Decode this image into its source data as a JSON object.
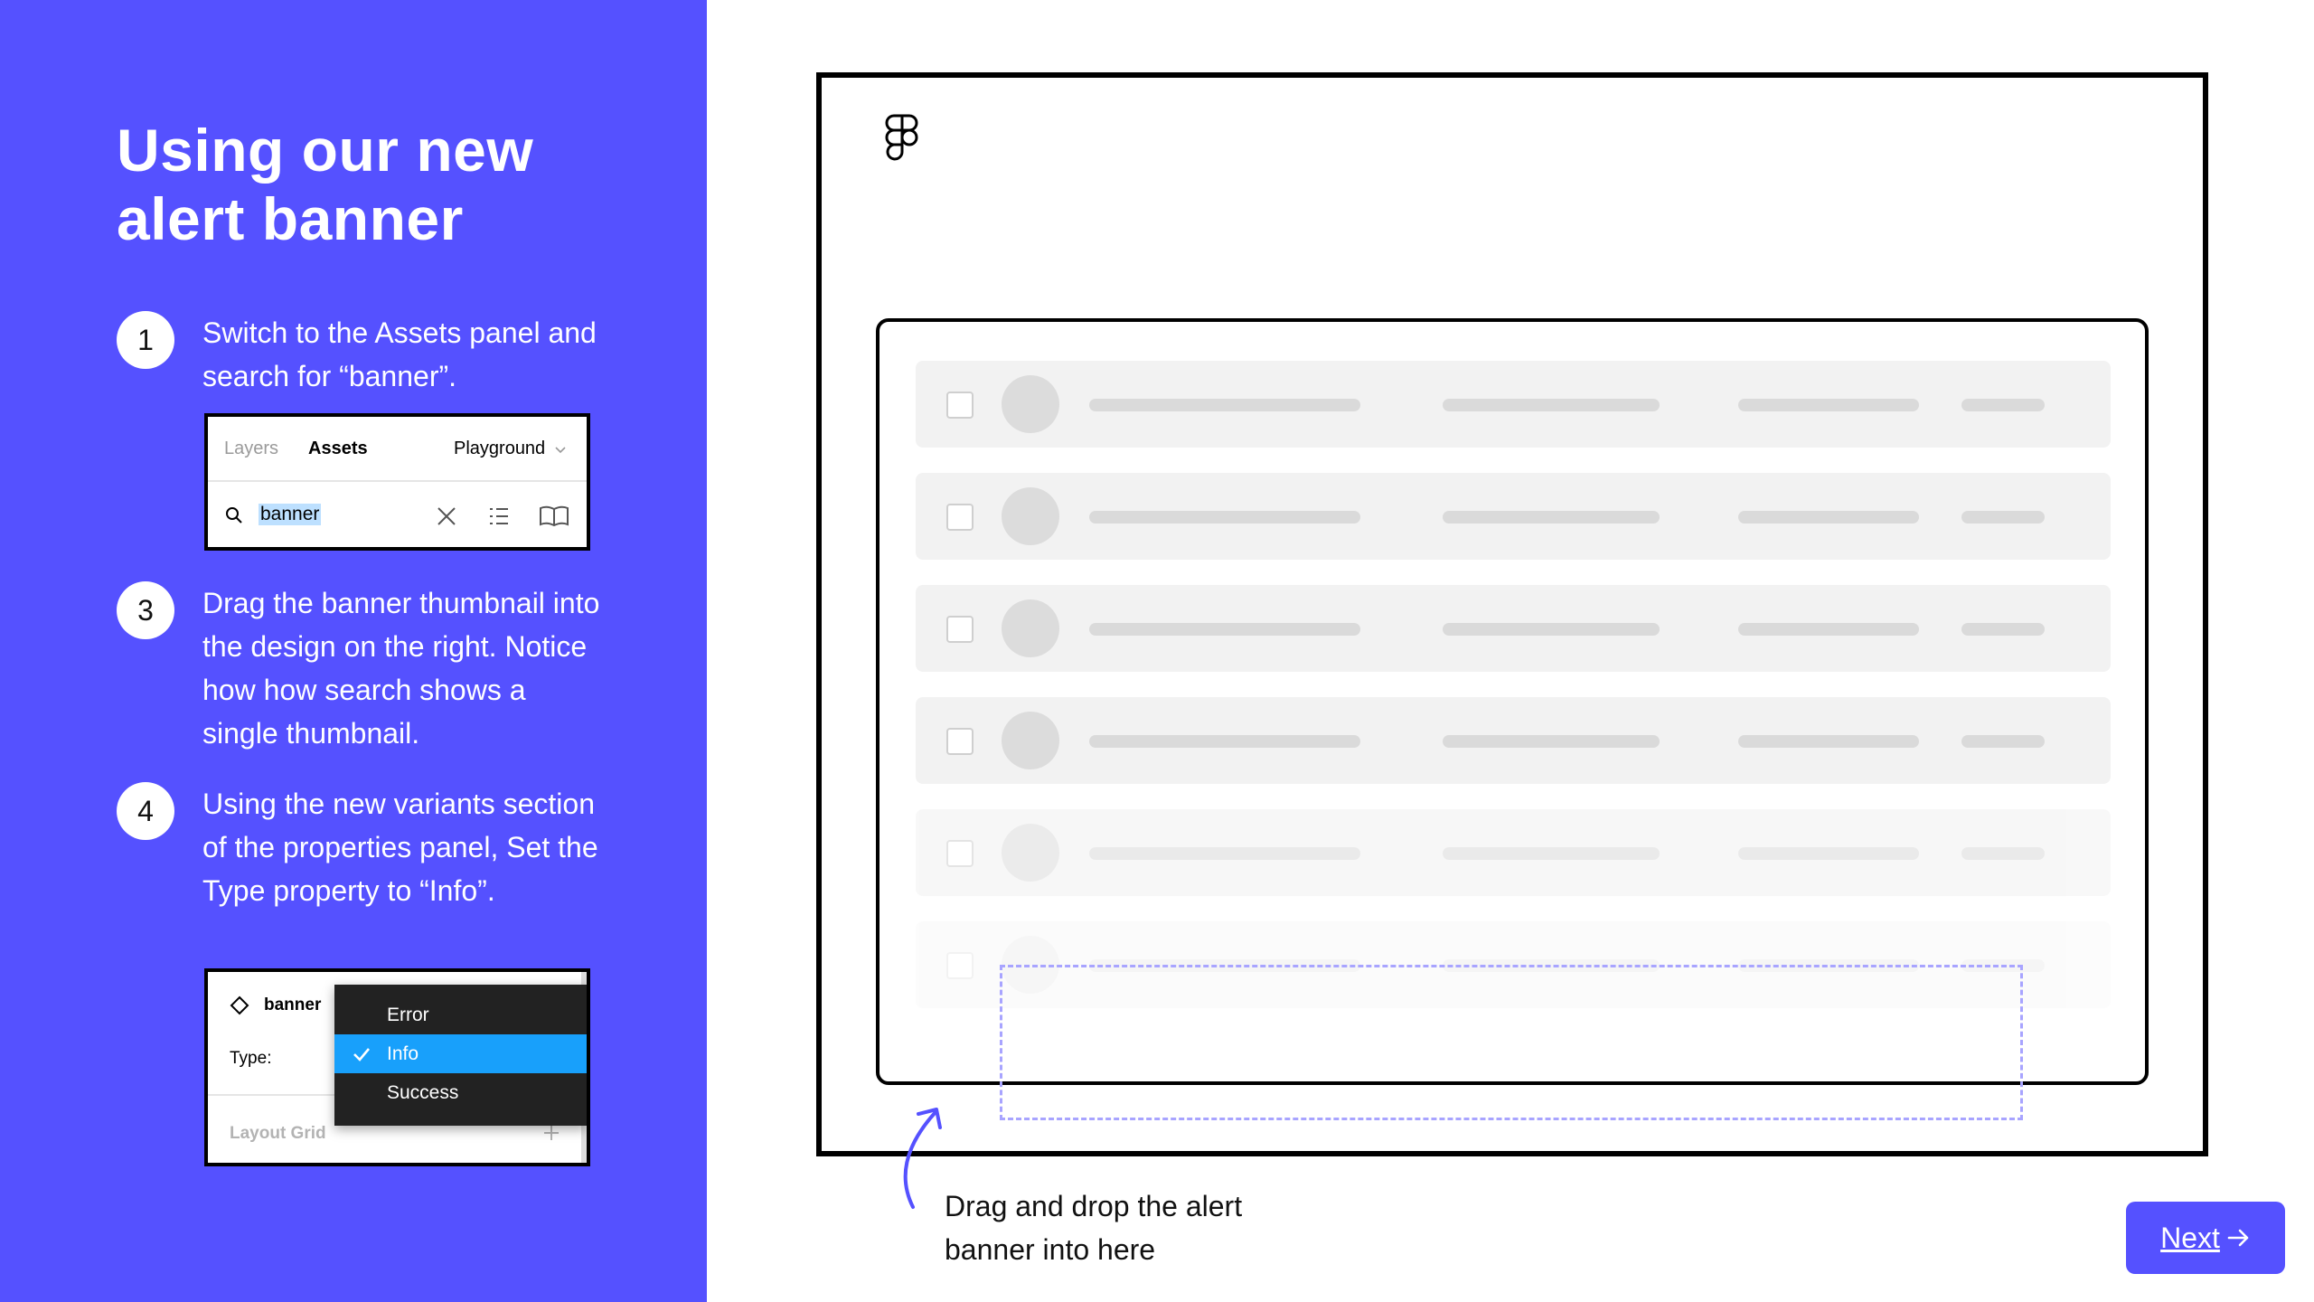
{
  "title": "Using our new alert banner",
  "steps": [
    {
      "number": "1",
      "text": "Switch to the Assets panel and search for “banner”."
    },
    {
      "number": "3",
      "text": "Drag the banner thumbnail into the design on the right. Notice how how search shows a single thumbnail."
    },
    {
      "number": "4",
      "text": "Using the new variants section of the properties panel, Set the Type property to “Info”."
    }
  ],
  "assets_panel": {
    "tabs": [
      "Layers",
      "Assets"
    ],
    "active_tab": "Assets",
    "library": "Playground",
    "search_value": "banner",
    "icons": [
      "search-icon",
      "clear-icon",
      "list-view-icon",
      "library-book-icon"
    ]
  },
  "properties_panel": {
    "component_name": "banner",
    "type_label": "Type:",
    "layout_grid_label": "Layout Grid",
    "options": [
      "Error",
      "Info",
      "Success"
    ],
    "selected_option": "Info"
  },
  "canvas": {
    "logo": "figma-logo-icon",
    "placeholder_rows": 6,
    "drop_caption": "Drag and drop the alert banner into here"
  },
  "next_button": {
    "label": "Next",
    "icon": "arrow-right-icon"
  },
  "colors": {
    "brand": "#5551ff",
    "selection": "#18a0fb",
    "dropdown_bg": "#222222",
    "drop_zone": "#a8a4ff"
  }
}
